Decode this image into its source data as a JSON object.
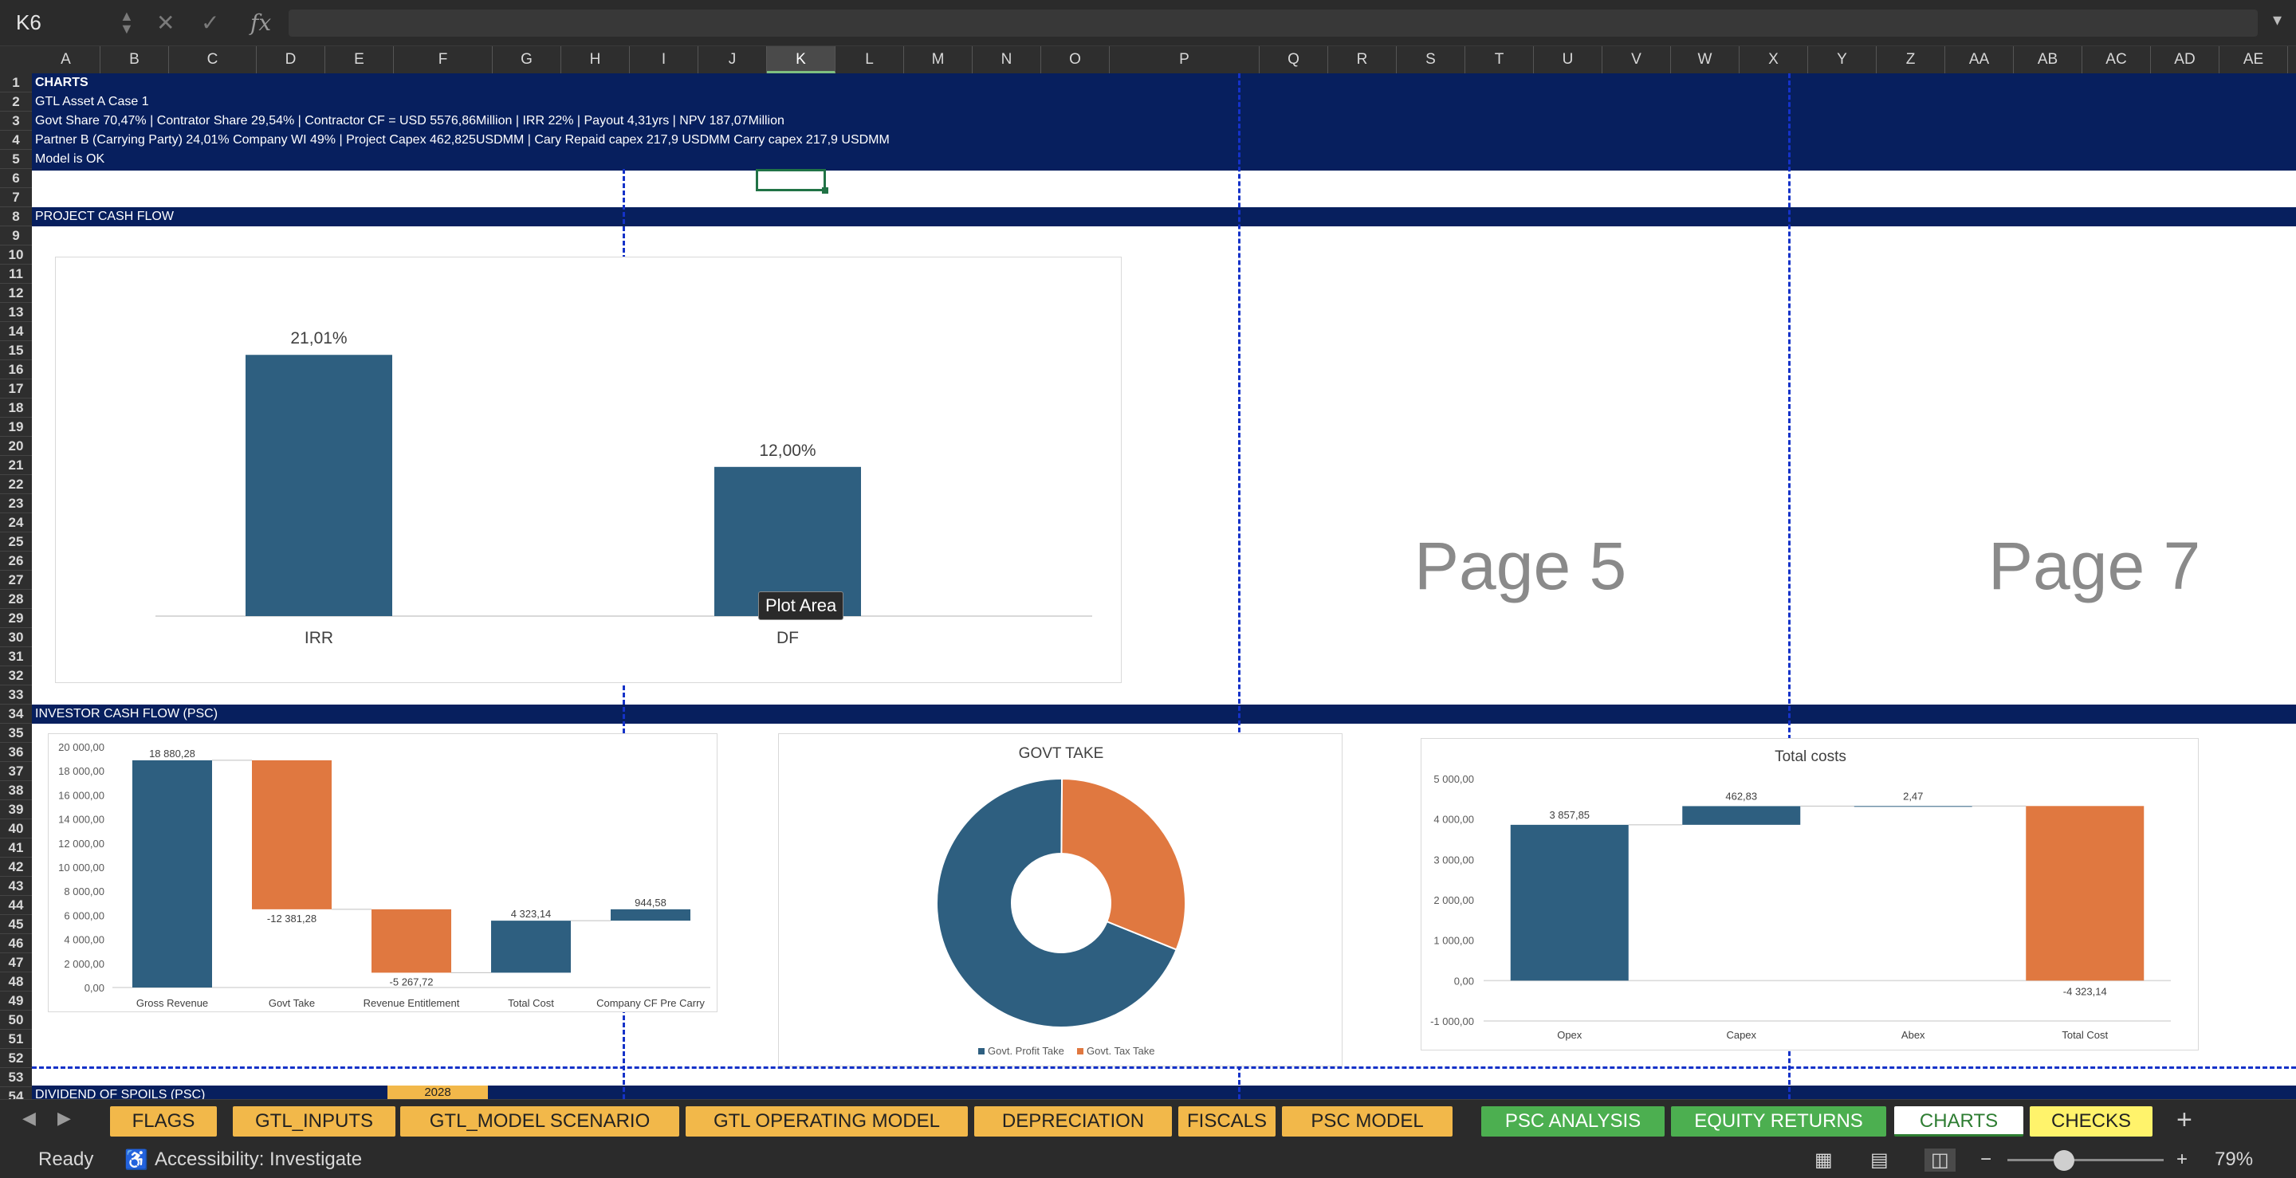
{
  "formula_bar": {
    "name_box": "K6",
    "fx": "fx",
    "formula": ""
  },
  "columns": [
    "A",
    "B",
    "C",
    "D",
    "E",
    "F",
    "G",
    "H",
    "I",
    "J",
    "K",
    "L",
    "M",
    "N",
    "O",
    "P",
    "Q",
    "R",
    "S",
    "T",
    "U",
    "V",
    "W",
    "X",
    "Y",
    "Z",
    "AA",
    "AB",
    "AC",
    "AD",
    "AE"
  ],
  "selected_column": "K",
  "rows": [
    "1",
    "2",
    "3",
    "4",
    "5",
    "6",
    "7",
    "8",
    "9",
    "10",
    "11",
    "12",
    "13",
    "14",
    "15",
    "16",
    "17",
    "18",
    "19",
    "20",
    "21",
    "22",
    "23",
    "24",
    "25",
    "26",
    "27",
    "28",
    "29",
    "30",
    "31",
    "32",
    "33",
    "34",
    "35",
    "36",
    "37",
    "38",
    "39",
    "40",
    "41",
    "42",
    "43",
    "44",
    "45",
    "46",
    "47",
    "48",
    "49",
    "50",
    "51",
    "52",
    "53",
    "54"
  ],
  "header_band": {
    "line1": "CHARTS",
    "line2": "GTL Asset A  Case 1",
    "line3": "Govt Share 70,47% | Contrator Share 29,54% |  Contractor CF = USD 5576,86Million | IRR 22% | Payout 4,31yrs | NPV 187,07Million",
    "line4": "Partner B (Carrying Party) 24,01% Company WI 49% |  Project Capex  462,825USDMM  |  Cary Repaid capex 217,9  USDMM Carry capex 217,9  USDMM",
    "line5": "Model is OK"
  },
  "sections": {
    "project_cash_flow": "PROJECT CASH FLOW",
    "investor_cash_flow": "INVESTOR CASH FLOW (PSC)",
    "dividend": "DIVIDEND OF SPOILS (PSC)",
    "dividend_year": "2028"
  },
  "page_labels": {
    "page5": "Page 5",
    "page7": "Page 7"
  },
  "tooltip": "Plot Area",
  "colors": {
    "blue": "#2e5f80",
    "orange": "#e07840",
    "navy": "#071f5e",
    "selection": "#217346"
  },
  "chart_data": [
    {
      "type": "bar",
      "categories": [
        "IRR",
        "DF"
      ],
      "values": [
        21.01,
        12.0
      ],
      "value_labels": [
        "21,01%",
        "12,00%"
      ],
      "ylim": [
        0,
        25
      ],
      "color": "#2e5f80"
    },
    {
      "type": "bar",
      "subtype": "waterfall",
      "categories": [
        "Gross Revenue",
        "Govt Take",
        "Revenue Entitlement",
        "Total Cost",
        "Company CF Pre Carry"
      ],
      "values": [
        18880.28,
        -12381.28,
        -5267.72,
        4323.14,
        944.58
      ],
      "value_labels": [
        "18 880,28",
        "-12 381,28",
        "-5 267,72",
        "4 323,14",
        "944,58"
      ],
      "floats": [
        [
          0,
          18880.28
        ],
        [
          6499.0,
          18880.28
        ],
        [
          1231.28,
          6499.0
        ],
        [
          1231.28,
          5554.42
        ],
        [
          5554.42,
          6499.0
        ]
      ],
      "bar_colors": [
        "#2e5f80",
        "#e07840",
        "#e07840",
        "#2e5f80",
        "#2e5f80"
      ],
      "ylim": [
        0,
        20000
      ],
      "ytick_labels": [
        "0,00",
        "2 000,00",
        "4 000,00",
        "6 000,00",
        "8 000,00",
        "10 000,00",
        "12 000,00",
        "14 000,00",
        "16 000,00",
        "18 000,00",
        "20 000,00"
      ]
    },
    {
      "type": "pie",
      "subtype": "donut",
      "title": "GOVT TAKE",
      "labels": [
        "Govt. Profit Take",
        "Govt. Tax Take"
      ],
      "values": [
        69.0,
        31.0
      ],
      "colors": [
        "#2e5f80",
        "#e07840"
      ],
      "legend": "bottom"
    },
    {
      "type": "bar",
      "subtype": "waterfall",
      "title": "Total costs",
      "categories": [
        "Opex",
        "Capex",
        "Abex",
        "Total Cost"
      ],
      "values": [
        3857.85,
        462.83,
        2.47,
        -4323.14
      ],
      "value_labels": [
        "3 857,85",
        "462,83",
        "2,47",
        "-4 323,14"
      ],
      "floats": [
        [
          0,
          3857.85
        ],
        [
          3857.85,
          4320.68
        ],
        [
          4320.68,
          4323.15
        ],
        [
          0,
          4323.14
        ]
      ],
      "bar_colors": [
        "#2e5f80",
        "#2e5f80",
        "#2e5f80",
        "#e07840"
      ],
      "ylim": [
        -1000,
        5000
      ],
      "ytick_labels": [
        "-1 000,00",
        "0,00",
        "1 000,00",
        "2 000,00",
        "3 000,00",
        "4 000,00",
        "5 000,00"
      ]
    }
  ],
  "tabs": [
    {
      "label": "FLAGS",
      "style": "y"
    },
    {
      "label": "GTL_INPUTS",
      "style": "y"
    },
    {
      "label": "GTL_MODEL SCENARIO",
      "style": "y"
    },
    {
      "label": "GTL OPERATING MODEL",
      "style": "y"
    },
    {
      "label": "DEPRECIATION",
      "style": "y"
    },
    {
      "label": "FISCALS",
      "style": "y"
    },
    {
      "label": "PSC MODEL",
      "style": "y"
    },
    {
      "label": "PSC ANALYSIS",
      "style": "g"
    },
    {
      "label": "EQUITY RETURNS",
      "style": "g"
    },
    {
      "label": "CHARTS",
      "style": "act"
    },
    {
      "label": "CHECKS",
      "style": "ly"
    }
  ],
  "status": {
    "ready": "Ready",
    "accessibility": "Accessibility: Investigate",
    "zoom": "79%"
  }
}
